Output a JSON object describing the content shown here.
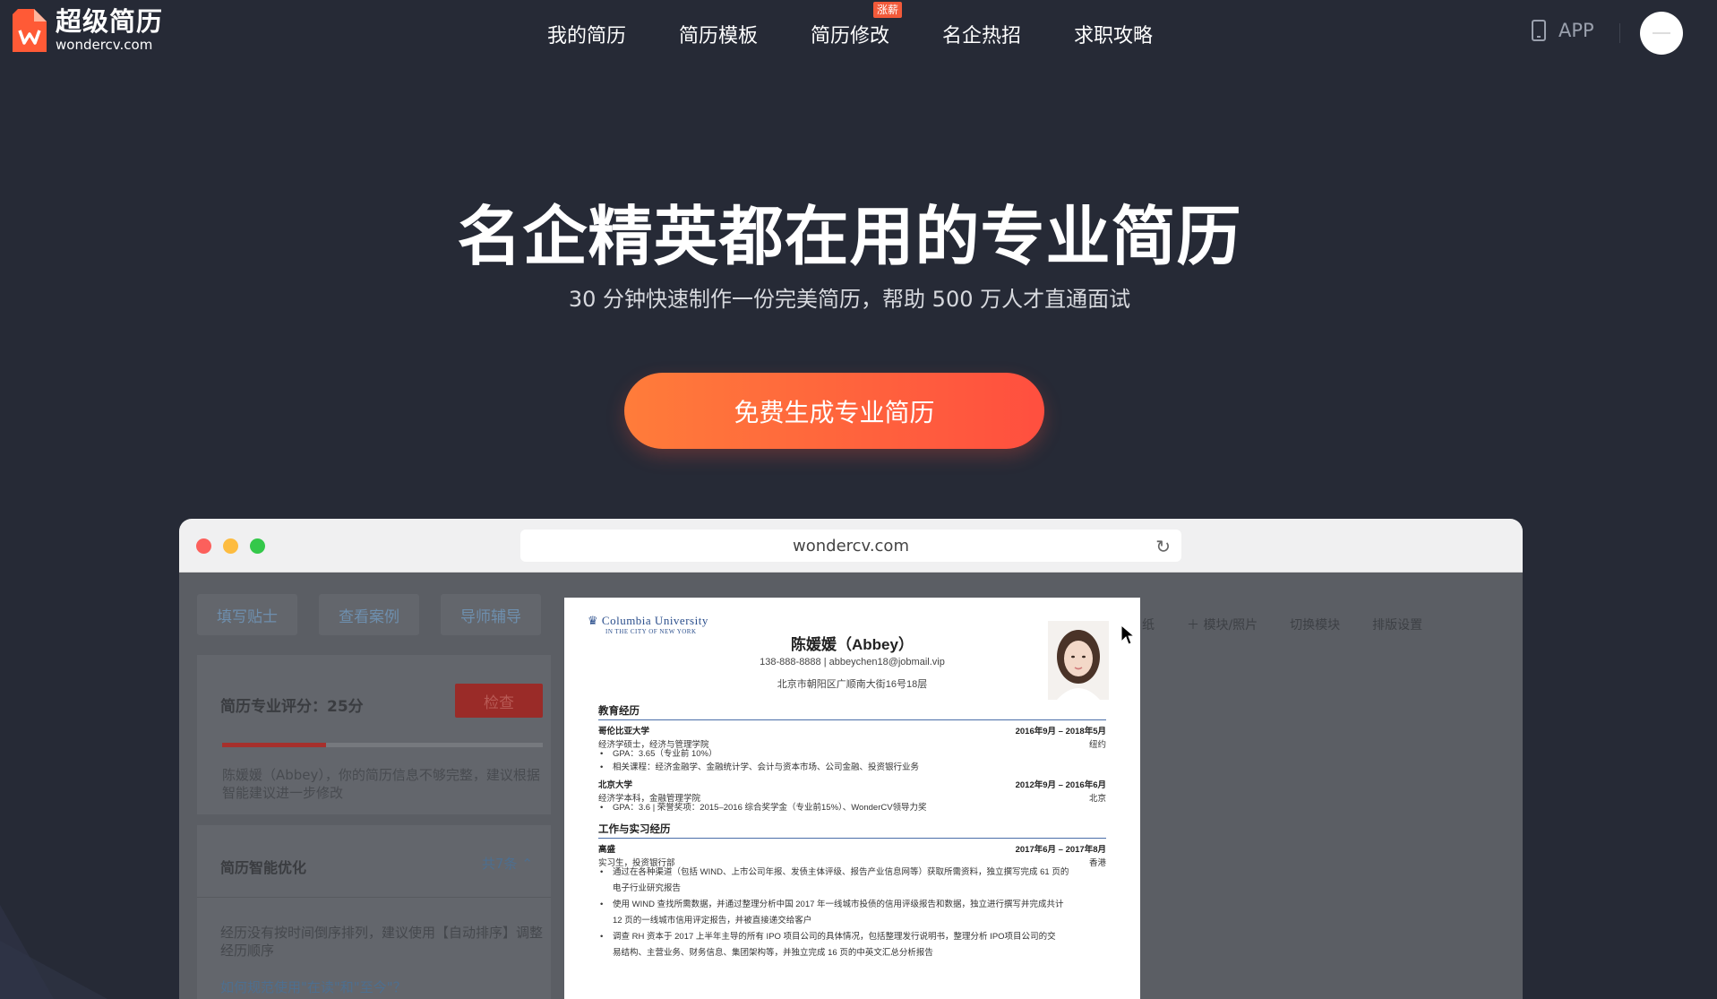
{
  "nav": {
    "logo_cn": "超级简历",
    "logo_en": "wondercv.com",
    "items": [
      {
        "label": "我的简历"
      },
      {
        "label": "简历模板"
      },
      {
        "label": "简历修改",
        "badge": "涨薪"
      },
      {
        "label": "名企热招"
      },
      {
        "label": "求职攻略"
      }
    ],
    "app_label": "APP"
  },
  "hero": {
    "title": "名企精英都在用的专业简历",
    "subtitle": "30 分钟快速制作一份完美简历，帮助 500 万人才直通面试",
    "cta": "免费生成专业简历"
  },
  "browser": {
    "url": "wondercv.com"
  },
  "editor": {
    "tabs": [
      "填写贴士",
      "查看案例",
      "导师辅导"
    ],
    "score_label": "简历专业评分：25分",
    "score_percent": 0.325,
    "check_button": "检查",
    "score_message": "陈媛媛（Abbey），你的简历信息不够完整，建议根据智能建议进一步修改",
    "optimize_title": "简历智能优化",
    "optimize_count": "共7条",
    "optimize_text": "经历没有按时间倒序排列，建议使用【自动排序】调整经历顺序",
    "optimize_link": "如何规范使用\"在读\"和\"至今\"？",
    "tools": [
      "纸",
      "＋ 模块/照片",
      "切换模块",
      "排版设置"
    ]
  },
  "resume": {
    "university": "Columbia University",
    "university_sub": "IN THE CITY OF NEW YORK",
    "name": "陈媛媛（Abbey）",
    "contact": "138-888-8888 | abbeychen18@jobmail.vip",
    "address": "北京市朝阳区广顺南大街16号18层",
    "education_title": "教育经历",
    "edu1_school": "哥伦比亚大学",
    "edu1_date": "2016年9月 – 2018年5月",
    "edu1_degree": "经济学硕士，经济与管理学院",
    "edu1_location": "纽约",
    "edu1_b1": "GPA：3.65（专业前 10%）",
    "edu1_b2": "相关课程：经济金融学、金融统计学、会计与资本市场、公司金融、投资银行业务",
    "edu2_school": "北京大学",
    "edu2_date": "2012年9月 – 2016年6月",
    "edu2_degree": "经济学本科，金融管理学院",
    "edu2_location": "北京",
    "edu2_b1": "GPA：3.6 | 荣誉奖项：2015–2016 综合奖学金（专业前15%）、WonderCV领导力奖",
    "work_title": "工作与实习经历",
    "work1_company": "高盛",
    "work1_date": "2017年6月 – 2017年8月",
    "work1_role": "实习生，投资银行部",
    "work1_location": "香港",
    "work1_b1": "通过在各种渠道（包括 WIND、上市公司年报、发债主体评级、报告产业信息网等）获取所需资料，独立撰写完成 61 页的",
    "work1_b1b": "电子行业研究报告",
    "work1_b2": "使用 WIND 查找所需数据，并通过整理分析中国 2017 年一线城市投债的信用评级报告和数据，独立进行撰写并完成共计",
    "work1_b2b": "12 页的一线城市信用评定报告，并被直接递交给客户",
    "work1_b3": "调查 RH 资本于 2017 上半年主导的所有 IPO 项目公司的具体情况，包括整理发行说明书，整理分析 IPO项目公司的交",
    "work1_b3b": "易结构、主营业务、财务信息、集团架构等，并独立完成 16 页的中英文汇总分析报告"
  }
}
